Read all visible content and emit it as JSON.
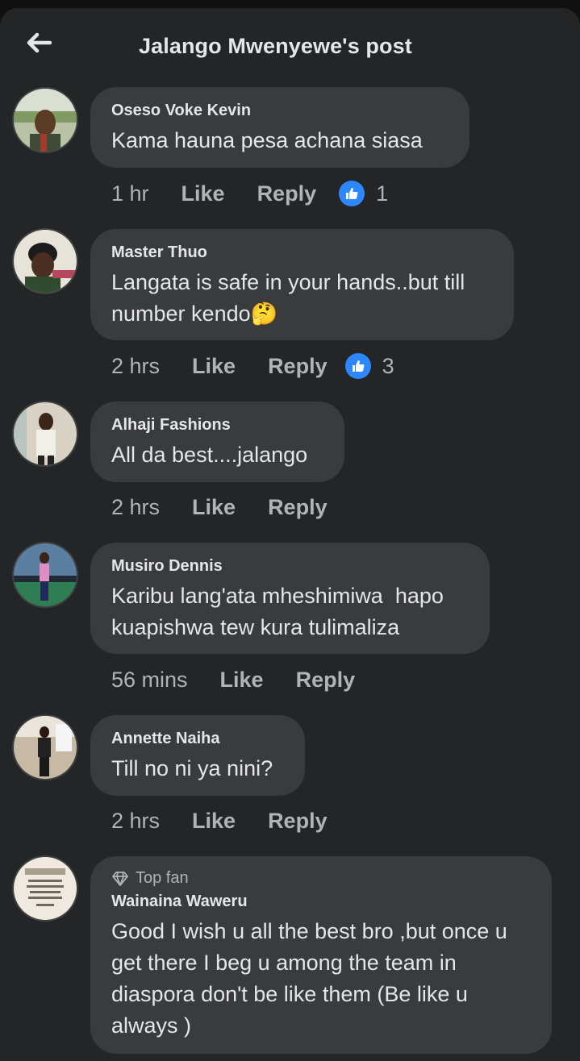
{
  "header": {
    "back_icon": "arrow-left-icon",
    "title": "Jalango Mwenyewe's post"
  },
  "comments": [
    {
      "author": "Oseso Voke Kevin",
      "text": "Kama hauna pesa achana siasa",
      "time": "1 hr",
      "like_label": "Like",
      "reply_label": "Reply",
      "reactions": "1"
    },
    {
      "author": "Master Thuo",
      "text_line1": "Langata is safe in your hands..but till",
      "text_line2": "number kendo",
      "emoji": "🤔",
      "time": "2 hrs",
      "like_label": "Like",
      "reply_label": "Reply",
      "reactions": "3"
    },
    {
      "author": "Alhaji Fashions",
      "text": "All da best....jalango",
      "time": "2 hrs",
      "like_label": "Like",
      "reply_label": "Reply"
    },
    {
      "author": "Musiro Dennis",
      "text_line1": "Karibu lang'ata mheshimiwa  hapo",
      "text_line2": "kuapishwa tew kura tulimaliza",
      "time": "56 mins",
      "like_label": "Like",
      "reply_label": "Reply"
    },
    {
      "author": "Annette Naiha",
      "text": "Till no ni ya nini?",
      "time": "2 hrs",
      "like_label": "Like",
      "reply_label": "Reply"
    },
    {
      "badge": "Top fan",
      "author": "Wainaina Waweru",
      "text_line1": "Good I wish u all the best bro ,but once u",
      "text_line2": "get there I beg u among the team in",
      "text_line3": "diaspora don't be like them (Be like u",
      "text_line4": "always )"
    }
  ],
  "colors": {
    "background": "#242526",
    "bubble": "#3a3b3c",
    "text": "#e4e6eb",
    "secondary_text": "#b0b3b8",
    "like_blue": "#2d88ff"
  }
}
